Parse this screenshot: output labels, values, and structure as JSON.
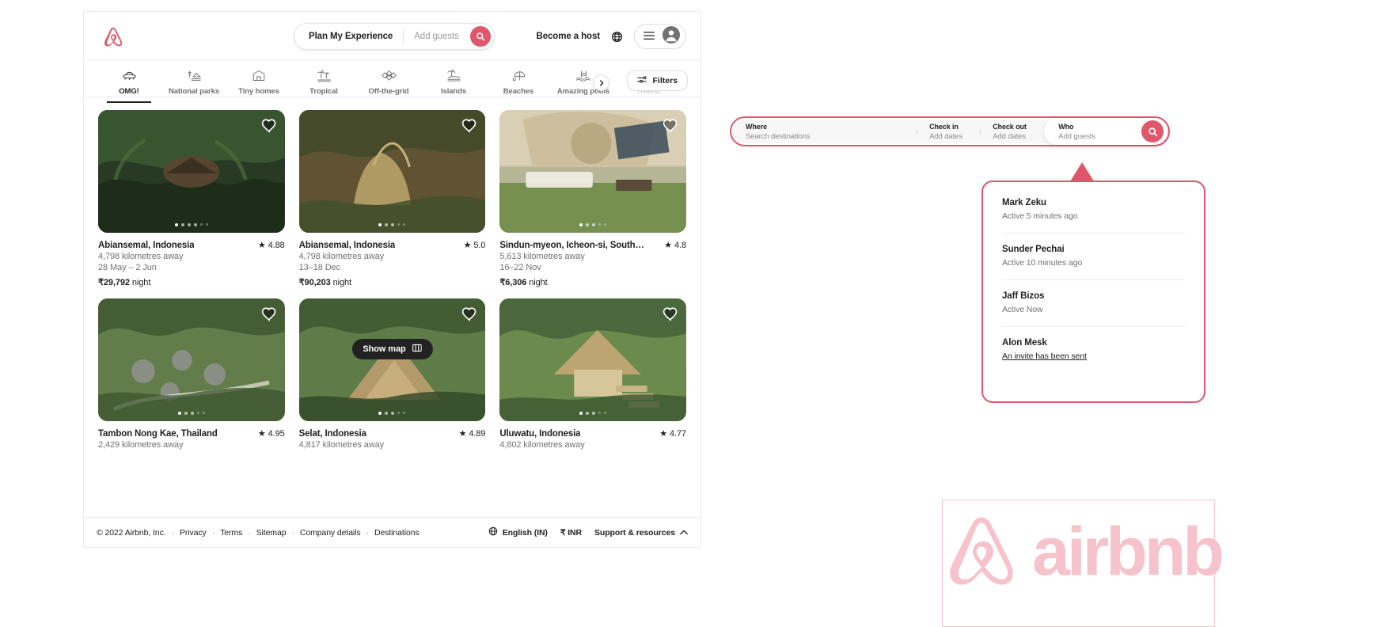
{
  "header": {
    "logo_icon": "airbnb-logo-icon",
    "search_label": "Plan My Experience",
    "guests_placeholder": "Add guests",
    "search_icon": "search-icon",
    "become_host": "Become a host",
    "globe_icon": "globe-icon",
    "menu_icon": "hamburger-menu-icon",
    "avatar_icon": "user-avatar-icon",
    "accent": "#e0566b"
  },
  "categories": {
    "items": [
      {
        "label": "OMG!",
        "icon": "ufo-icon",
        "active": true
      },
      {
        "label": "National parks",
        "icon": "national-park-icon",
        "active": false
      },
      {
        "label": "Tiny homes",
        "icon": "tiny-home-icon",
        "active": false
      },
      {
        "label": "Tropical",
        "icon": "palm-tree-icon",
        "active": false
      },
      {
        "label": "Off-the-grid",
        "icon": "off-the-grid-icon",
        "active": false
      },
      {
        "label": "Islands",
        "icon": "island-icon",
        "active": false
      },
      {
        "label": "Beaches",
        "icon": "beach-umbrella-icon",
        "active": false
      },
      {
        "label": "Amazing pools",
        "icon": "pool-icon",
        "active": false
      },
      {
        "label": "Treeho",
        "icon": "treehouse-icon",
        "active": false
      }
    ],
    "next_icon": "chevron-right-icon",
    "filters_label": "Filters",
    "filters_icon": "filters-sliders-icon"
  },
  "listings": [
    {
      "title": "Abiansemal, Indonesia",
      "rating": "4.88",
      "distance": "4,798 kilometres away",
      "dates": "28 May – 2 Jun",
      "price": "₹29,792",
      "price_unit": "night",
      "dot_index": 0,
      "dot_count": 6
    },
    {
      "title": "Abiansemal, Indonesia",
      "rating": "5.0",
      "distance": "4,798 kilometres away",
      "dates": "13–18 Dec",
      "price": "₹90,203",
      "price_unit": "night",
      "dot_index": 0,
      "dot_count": 5
    },
    {
      "title": "Sindun-myeon, Icheon-si, South K…",
      "rating": "4.8",
      "distance": "5,613 kilometres away",
      "dates": "16–22 Nov",
      "price": "₹6,306",
      "price_unit": "night",
      "dot_index": 0,
      "dot_count": 5
    },
    {
      "title": "Tambon Nong Kae, Thailand",
      "rating": "4.95",
      "distance": "2,429 kilometres away",
      "dates": "",
      "price": "",
      "price_unit": "",
      "dot_index": 0,
      "dot_count": 5
    },
    {
      "title": "Selat, Indonesia",
      "rating": "4.89",
      "distance": "4,817 kilometres away",
      "dates": "",
      "price": "",
      "price_unit": "",
      "dot_index": 0,
      "dot_count": 5
    },
    {
      "title": "Uluwatu, Indonesia",
      "rating": "4.77",
      "distance": "4,802 kilometres away",
      "dates": "",
      "price": "",
      "price_unit": "",
      "dot_index": 0,
      "dot_count": 5
    }
  ],
  "show_map": {
    "label": "Show map",
    "icon": "map-icon"
  },
  "footer": {
    "copyright": "© 2022 Airbnb, Inc.",
    "links": [
      "Privacy",
      "Terms",
      "Sitemap",
      "Company details",
      "Destinations"
    ],
    "language": "English (IN)",
    "language_icon": "globe-icon",
    "currency": "₹ INR",
    "support": "Support & resources",
    "support_icon": "chevron-up-icon"
  },
  "big_search": {
    "where_label": "Where",
    "where_placeholder": "Search destinations",
    "checkin_label": "Check in",
    "checkin_value": "Add dates",
    "checkout_label": "Check out",
    "checkout_value": "Add dates",
    "who_label": "Who",
    "who_value": "Add guests",
    "search_icon": "search-icon",
    "highlight_color": "#e0566b"
  },
  "popup": {
    "highlight_color": "#e0566b",
    "people": [
      {
        "name": "Mark Zeku",
        "status": "Active 5 minutes ago",
        "is_link": false
      },
      {
        "name": "Sunder Pechai",
        "status": "Active 10 minutes ago",
        "is_link": false
      },
      {
        "name": "Jaff Bizos",
        "status": "Active Now",
        "is_link": false
      },
      {
        "name": "Alon Mesk",
        "status": "An invite has been sent",
        "is_link": true
      }
    ]
  },
  "brand": {
    "wordmark": "airbnb",
    "logo_icon": "airbnb-logo-icon",
    "color": "#f6c2cb"
  }
}
